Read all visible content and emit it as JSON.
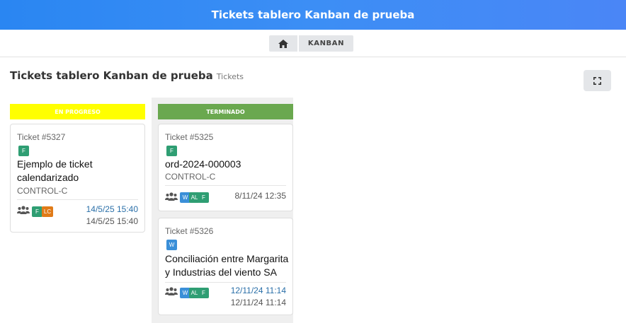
{
  "app": {
    "title": "Tickets tablero Kanban de prueba"
  },
  "breadcrumb": {
    "home_icon": "home-icon",
    "kanban_label": "KANBAN"
  },
  "page": {
    "title": "Tickets tablero Kanban de prueba",
    "subtitle": "Tickets",
    "fullscreen_icon": "expand-icon"
  },
  "columns": [
    {
      "label": "EN PROGRESO",
      "color": "#ffff00",
      "cards": [
        {
          "ticket": "Ticket #5327",
          "tag": "F",
          "title_lines": [
            "Ejemplo de ticket",
            "calendarizado"
          ],
          "client": "CONTROL-C",
          "assignees": [
            "F",
            "LC"
          ],
          "date_primary": "14/5/25 15:40",
          "date_secondary": "14/5/25 15:40"
        }
      ]
    },
    {
      "label": "TERMINADO",
      "color": "#6aa84f",
      "cards": [
        {
          "ticket": "Ticket #5325",
          "tag": "F",
          "title_lines": [
            "ord-2024-000003"
          ],
          "client": "CONTROL-C",
          "assignees": [
            "W",
            "AL",
            "F"
          ],
          "date_primary": "8/11/24 12:35"
        },
        {
          "ticket": "Ticket #5326",
          "tag": "W",
          "title_lines": [
            "Conciliación entre Margarita",
            "y Industrias del viento SA"
          ],
          "assignees": [
            "W",
            "AL",
            "F"
          ],
          "date_primary": "12/11/24 11:14",
          "date_secondary": "12/11/24 11:14"
        }
      ]
    }
  ]
}
